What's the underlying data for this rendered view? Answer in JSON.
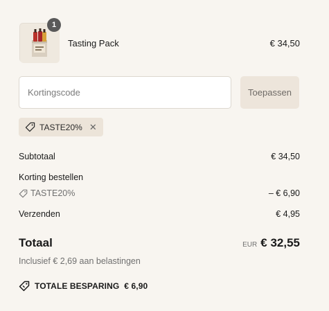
{
  "cart": {
    "item": {
      "name": "Tasting Pack",
      "price": "€ 34,50",
      "quantity": "1"
    }
  },
  "discount": {
    "placeholder": "Kortingscode",
    "apply_label": "Toepassen",
    "applied_code": "TASTE20%",
    "remove_symbol": "✕"
  },
  "summary": {
    "subtotal_label": "Subtotaal",
    "subtotal_value": "€ 34,50",
    "discount_label": "Korting bestellen",
    "discount_code": "TASTE20%",
    "discount_value": "– € 6,90",
    "shipping_label": "Verzenden",
    "shipping_value": "€ 4,95",
    "total_label": "Totaal",
    "currency": "EUR",
    "total_value": "€ 32,55",
    "tax_note": "Inclusief € 2,69 aan belastingen",
    "savings_label": "TOTALE BESPARING",
    "savings_value": "€ 6,90"
  },
  "colors": {
    "background": "#f8f5f0",
    "badge": "#595959",
    "apply_button": "#ede5db",
    "tag": "#ece4d9"
  },
  "icons": {
    "tag": "tag-icon",
    "savings": "savings-tag-icon"
  }
}
